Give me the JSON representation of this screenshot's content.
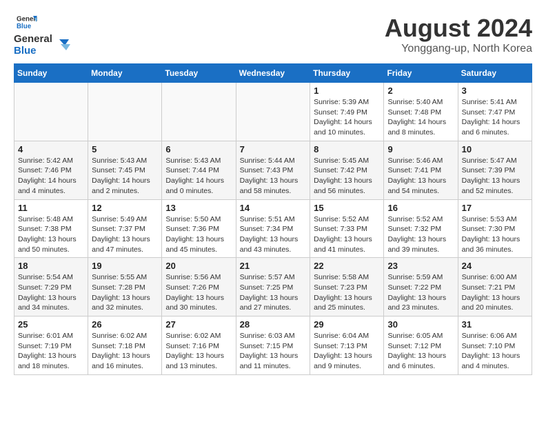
{
  "header": {
    "logo_line1": "General",
    "logo_line2": "Blue",
    "month_title": "August 2024",
    "location": "Yonggang-up, North Korea"
  },
  "weekdays": [
    "Sunday",
    "Monday",
    "Tuesday",
    "Wednesday",
    "Thursday",
    "Friday",
    "Saturday"
  ],
  "weeks": [
    [
      {
        "day": "",
        "info": ""
      },
      {
        "day": "",
        "info": ""
      },
      {
        "day": "",
        "info": ""
      },
      {
        "day": "",
        "info": ""
      },
      {
        "day": "1",
        "info": "Sunrise: 5:39 AM\nSunset: 7:49 PM\nDaylight: 14 hours\nand 10 minutes."
      },
      {
        "day": "2",
        "info": "Sunrise: 5:40 AM\nSunset: 7:48 PM\nDaylight: 14 hours\nand 8 minutes."
      },
      {
        "day": "3",
        "info": "Sunrise: 5:41 AM\nSunset: 7:47 PM\nDaylight: 14 hours\nand 6 minutes."
      }
    ],
    [
      {
        "day": "4",
        "info": "Sunrise: 5:42 AM\nSunset: 7:46 PM\nDaylight: 14 hours\nand 4 minutes."
      },
      {
        "day": "5",
        "info": "Sunrise: 5:43 AM\nSunset: 7:45 PM\nDaylight: 14 hours\nand 2 minutes."
      },
      {
        "day": "6",
        "info": "Sunrise: 5:43 AM\nSunset: 7:44 PM\nDaylight: 14 hours\nand 0 minutes."
      },
      {
        "day": "7",
        "info": "Sunrise: 5:44 AM\nSunset: 7:43 PM\nDaylight: 13 hours\nand 58 minutes."
      },
      {
        "day": "8",
        "info": "Sunrise: 5:45 AM\nSunset: 7:42 PM\nDaylight: 13 hours\nand 56 minutes."
      },
      {
        "day": "9",
        "info": "Sunrise: 5:46 AM\nSunset: 7:41 PM\nDaylight: 13 hours\nand 54 minutes."
      },
      {
        "day": "10",
        "info": "Sunrise: 5:47 AM\nSunset: 7:39 PM\nDaylight: 13 hours\nand 52 minutes."
      }
    ],
    [
      {
        "day": "11",
        "info": "Sunrise: 5:48 AM\nSunset: 7:38 PM\nDaylight: 13 hours\nand 50 minutes."
      },
      {
        "day": "12",
        "info": "Sunrise: 5:49 AM\nSunset: 7:37 PM\nDaylight: 13 hours\nand 47 minutes."
      },
      {
        "day": "13",
        "info": "Sunrise: 5:50 AM\nSunset: 7:36 PM\nDaylight: 13 hours\nand 45 minutes."
      },
      {
        "day": "14",
        "info": "Sunrise: 5:51 AM\nSunset: 7:34 PM\nDaylight: 13 hours\nand 43 minutes."
      },
      {
        "day": "15",
        "info": "Sunrise: 5:52 AM\nSunset: 7:33 PM\nDaylight: 13 hours\nand 41 minutes."
      },
      {
        "day": "16",
        "info": "Sunrise: 5:52 AM\nSunset: 7:32 PM\nDaylight: 13 hours\nand 39 minutes."
      },
      {
        "day": "17",
        "info": "Sunrise: 5:53 AM\nSunset: 7:30 PM\nDaylight: 13 hours\nand 36 minutes."
      }
    ],
    [
      {
        "day": "18",
        "info": "Sunrise: 5:54 AM\nSunset: 7:29 PM\nDaylight: 13 hours\nand 34 minutes."
      },
      {
        "day": "19",
        "info": "Sunrise: 5:55 AM\nSunset: 7:28 PM\nDaylight: 13 hours\nand 32 minutes."
      },
      {
        "day": "20",
        "info": "Sunrise: 5:56 AM\nSunset: 7:26 PM\nDaylight: 13 hours\nand 30 minutes."
      },
      {
        "day": "21",
        "info": "Sunrise: 5:57 AM\nSunset: 7:25 PM\nDaylight: 13 hours\nand 27 minutes."
      },
      {
        "day": "22",
        "info": "Sunrise: 5:58 AM\nSunset: 7:23 PM\nDaylight: 13 hours\nand 25 minutes."
      },
      {
        "day": "23",
        "info": "Sunrise: 5:59 AM\nSunset: 7:22 PM\nDaylight: 13 hours\nand 23 minutes."
      },
      {
        "day": "24",
        "info": "Sunrise: 6:00 AM\nSunset: 7:21 PM\nDaylight: 13 hours\nand 20 minutes."
      }
    ],
    [
      {
        "day": "25",
        "info": "Sunrise: 6:01 AM\nSunset: 7:19 PM\nDaylight: 13 hours\nand 18 minutes."
      },
      {
        "day": "26",
        "info": "Sunrise: 6:02 AM\nSunset: 7:18 PM\nDaylight: 13 hours\nand 16 minutes."
      },
      {
        "day": "27",
        "info": "Sunrise: 6:02 AM\nSunset: 7:16 PM\nDaylight: 13 hours\nand 13 minutes."
      },
      {
        "day": "28",
        "info": "Sunrise: 6:03 AM\nSunset: 7:15 PM\nDaylight: 13 hours\nand 11 minutes."
      },
      {
        "day": "29",
        "info": "Sunrise: 6:04 AM\nSunset: 7:13 PM\nDaylight: 13 hours\nand 9 minutes."
      },
      {
        "day": "30",
        "info": "Sunrise: 6:05 AM\nSunset: 7:12 PM\nDaylight: 13 hours\nand 6 minutes."
      },
      {
        "day": "31",
        "info": "Sunrise: 6:06 AM\nSunset: 7:10 PM\nDaylight: 13 hours\nand 4 minutes."
      }
    ]
  ]
}
